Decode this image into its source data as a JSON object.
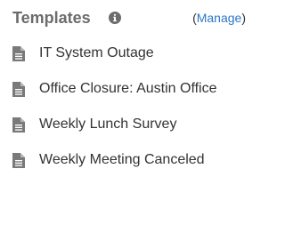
{
  "header": {
    "title": "Templates",
    "info_icon": "info-circle-icon",
    "manage_open": "(",
    "manage_label": "Manage",
    "manage_close": ")"
  },
  "templates": [
    {
      "label": "IT System Outage",
      "icon": "document-icon"
    },
    {
      "label": "Office Closure: Austin Office",
      "icon": "document-icon"
    },
    {
      "label": "Weekly Lunch Survey",
      "icon": "document-icon"
    },
    {
      "label": "Weekly Meeting Canceled",
      "icon": "document-icon"
    }
  ],
  "colors": {
    "title": "#6c6c6c",
    "link": "#2e76c8",
    "text": "#333333",
    "icon": "#7a7a7a"
  }
}
